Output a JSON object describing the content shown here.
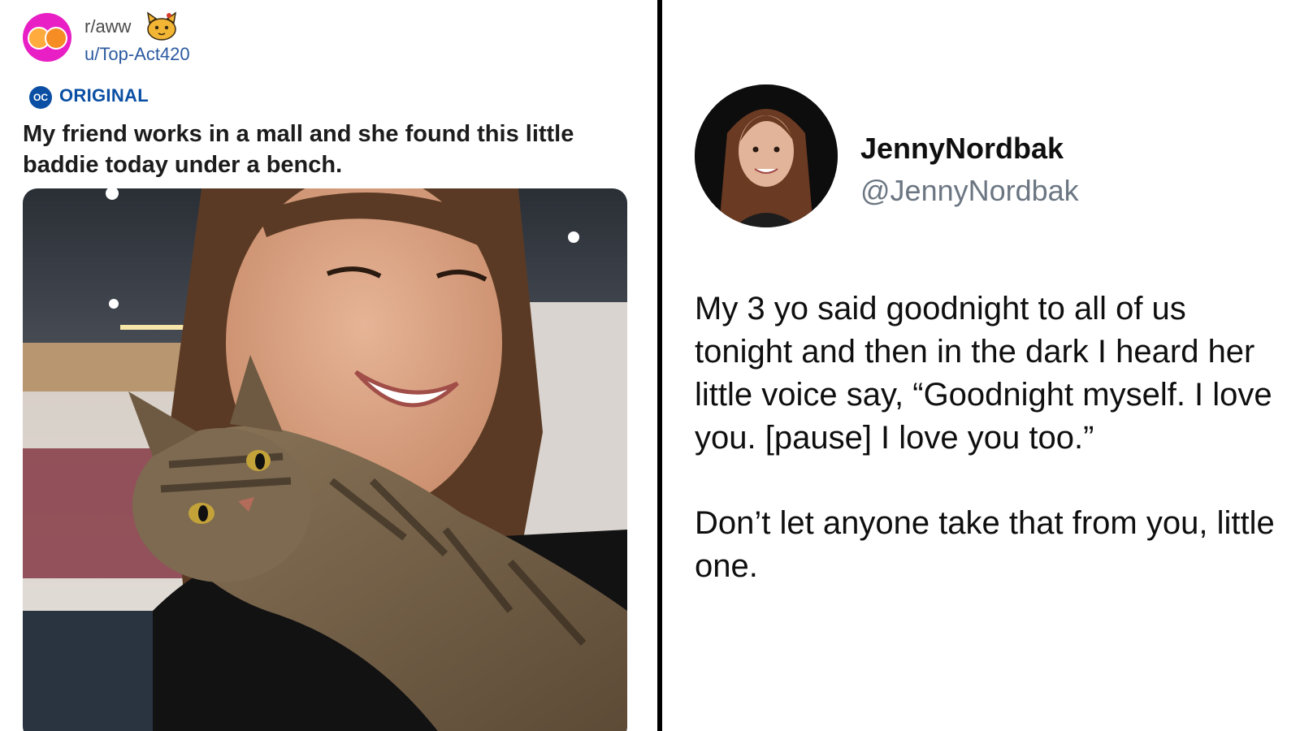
{
  "reddit_post": {
    "subreddit": "r/aww",
    "username": "u/Top-Act420",
    "oc_badge": "OC",
    "flair": "ORIGINAL",
    "title": "My friend works in a mall and she found this little baddie today under a bench."
  },
  "tweet": {
    "display_name": "JennyNordbak",
    "handle": "@JennyNordbak",
    "paragraphs": [
      "My 3 yo said goodnight to all of us tonight and then in the dark I heard her little voice say, “Goodnight myself. I love you. [pause] I love you too.”",
      "Don’t let anyone take that from you, little one."
    ]
  },
  "colors": {
    "subreddit_avatar": "#e81fc4",
    "username_link": "#2c5aa0",
    "oc_blue": "#0a4fa3",
    "handle_gray": "#6b7682",
    "divider": "#000000"
  }
}
